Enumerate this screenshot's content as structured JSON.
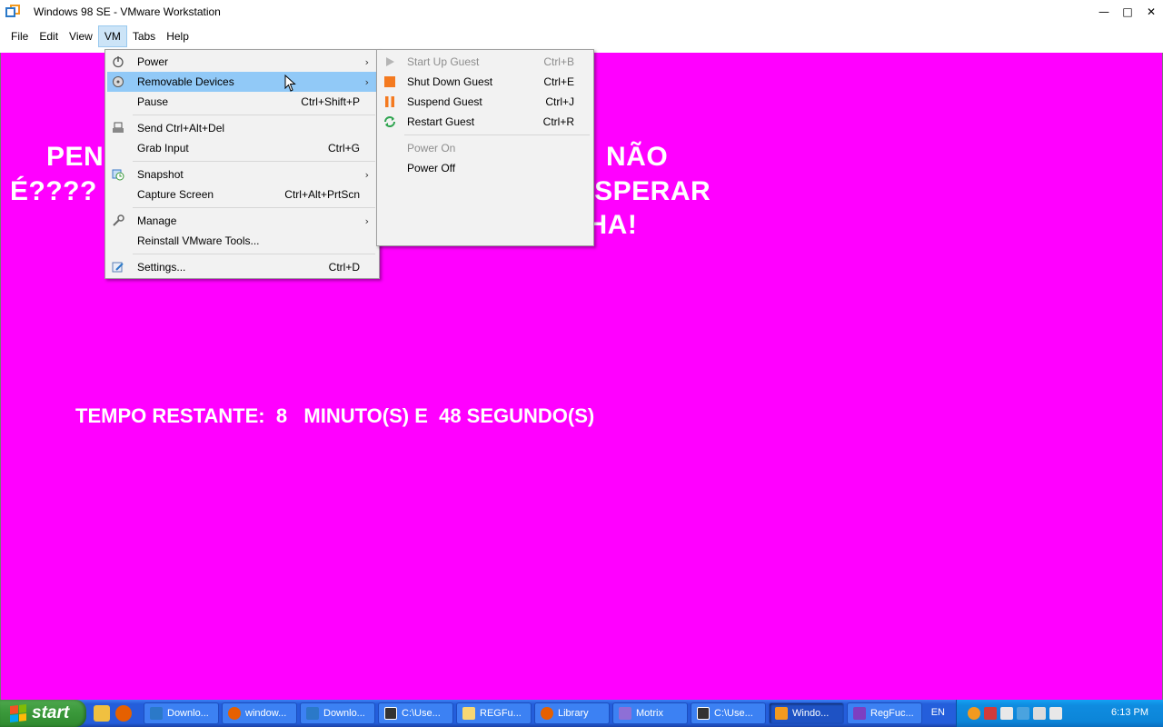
{
  "window": {
    "title": "Windows 98 SE - VMware Workstation",
    "minimize_glyph": "—",
    "maximize_glyph": "□",
    "close_glyph": "✕"
  },
  "menubar": {
    "items": [
      {
        "label": "File"
      },
      {
        "label": "Edit"
      },
      {
        "label": "View"
      },
      {
        "label": "VM"
      },
      {
        "label": "Tabs"
      },
      {
        "label": "Help"
      }
    ],
    "active": "VM"
  },
  "guest": {
    "background": "#ff00ff",
    "line1_left": "PEN",
    "line1_right": "NÃO",
    "line2_left": "É????",
    "line2_right": "O VOCE VAI ESPERAR",
    "line3_right": "HAHAAHAHAHA!",
    "timer": "TEMPO RESTANTE:  8   MINUTO(S) E  48 SEGUNDO(S)"
  },
  "vm_menu": {
    "items": [
      {
        "label": "Power",
        "shortcut": "",
        "submenu": true,
        "icon": "power-icon"
      },
      {
        "label": "Removable Devices",
        "shortcut": "",
        "submenu": true,
        "icon": "removable-devices-icon",
        "highlighted": true
      },
      {
        "label": "Pause",
        "shortcut": "Ctrl+Shift+P"
      },
      {
        "label": "Send Ctrl+Alt+Del",
        "shortcut": "",
        "icon": "keyboard-icon"
      },
      {
        "label": "Grab Input",
        "shortcut": "Ctrl+G"
      },
      {
        "label": "Snapshot",
        "shortcut": "",
        "submenu": true,
        "icon": "snapshot-icon"
      },
      {
        "label": "Capture Screen",
        "shortcut": "Ctrl+Alt+PrtScn"
      },
      {
        "label": "Manage",
        "shortcut": "",
        "submenu": true,
        "icon": "wrench-icon"
      },
      {
        "label": "Reinstall VMware Tools...",
        "shortcut": ""
      },
      {
        "label": "Settings...",
        "shortcut": "Ctrl+D",
        "icon": "settings-icon"
      }
    ]
  },
  "power_submenu": {
    "items": [
      {
        "label": "Start Up Guest",
        "shortcut": "Ctrl+B",
        "disabled": true,
        "icon": "play-icon"
      },
      {
        "label": "Shut Down Guest",
        "shortcut": "Ctrl+E",
        "icon": "stop-icon"
      },
      {
        "label": "Suspend Guest",
        "shortcut": "Ctrl+J",
        "icon": "pause-icon"
      },
      {
        "label": "Restart Guest",
        "shortcut": "Ctrl+R",
        "icon": "restart-icon"
      },
      {
        "label": "Power On",
        "shortcut": "",
        "disabled": true
      },
      {
        "label": "Power Off",
        "shortcut": ""
      }
    ]
  },
  "taskbar": {
    "start_label": "start",
    "tasks": [
      {
        "label": "Downlo...",
        "color": "#2b79c8"
      },
      {
        "label": "window...",
        "color": "#e66000"
      },
      {
        "label": "Downlo...",
        "color": "#2b79c8"
      },
      {
        "label": "C:\\Use...",
        "color": "#333333"
      },
      {
        "label": "REGFu...",
        "color": "#f7d774"
      },
      {
        "label": "Library",
        "color": "#e66000"
      },
      {
        "label": "Motrix",
        "color": "#8e6fd6"
      },
      {
        "label": "C:\\Use...",
        "color": "#333333"
      },
      {
        "label": "Windo...",
        "color": "#f39a1f",
        "active": true
      },
      {
        "label": "RegFuc...",
        "color": "#7d3fc1"
      }
    ],
    "language": "EN",
    "clock": "6:13 PM"
  }
}
